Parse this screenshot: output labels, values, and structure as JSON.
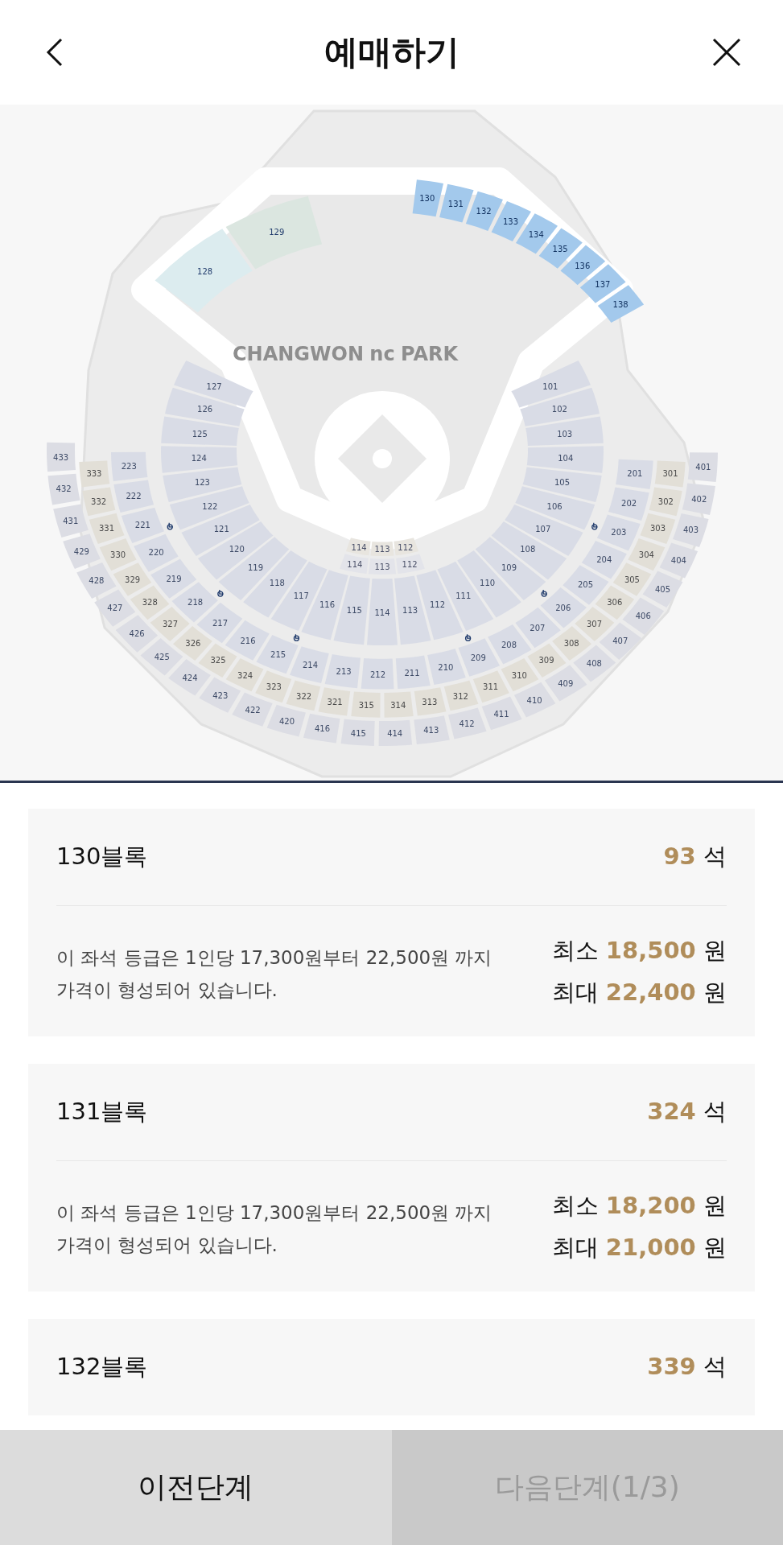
{
  "header": {
    "title": "예매하기"
  },
  "map": {
    "logo": [
      "CHANGWON",
      "nc",
      "PARK"
    ],
    "rings": [
      {
        "kind": "outfield-left",
        "sections": [
          {
            "label": "128",
            "selected": false,
            "color": "#dcecef"
          },
          {
            "label": "129",
            "selected": false,
            "color": "#dbe6e0"
          }
        ]
      },
      {
        "kind": "outfield-right",
        "sections": [
          {
            "label": "130",
            "selected": true
          },
          {
            "label": "131",
            "selected": true
          },
          {
            "label": "132",
            "selected": true
          },
          {
            "label": "133",
            "selected": true
          },
          {
            "label": "134",
            "selected": true
          },
          {
            "label": "135",
            "selected": true
          },
          {
            "label": "136",
            "selected": true
          },
          {
            "label": "137",
            "selected": true
          },
          {
            "label": "138",
            "selected": true
          }
        ]
      },
      {
        "kind": "lower-left",
        "sections": [
          {
            "label": "127",
            "selected": false
          },
          {
            "label": "126",
            "selected": false
          },
          {
            "label": "125",
            "selected": false
          },
          {
            "label": "124",
            "selected": false
          },
          {
            "label": "123",
            "selected": false
          },
          {
            "label": "122",
            "selected": false
          },
          {
            "label": "121",
            "selected": false
          },
          {
            "label": "120",
            "selected": false
          },
          {
            "label": "119",
            "selected": false
          },
          {
            "label": "118",
            "selected": false
          },
          {
            "label": "117",
            "selected": false
          },
          {
            "label": "116",
            "selected": false
          },
          {
            "label": "115",
            "selected": false
          },
          {
            "label": "114",
            "selected": false
          },
          {
            "label": "113",
            "selected": false
          },
          {
            "label": "112",
            "selected": false
          }
        ]
      },
      {
        "kind": "lower-right",
        "sections": [
          {
            "label": "101",
            "selected": false
          },
          {
            "label": "102",
            "selected": false
          },
          {
            "label": "103",
            "selected": false
          },
          {
            "label": "104",
            "selected": false
          },
          {
            "label": "105",
            "selected": false
          },
          {
            "label": "106",
            "selected": false
          },
          {
            "label": "107",
            "selected": false
          },
          {
            "label": "108",
            "selected": false
          },
          {
            "label": "109",
            "selected": false
          },
          {
            "label": "110",
            "selected": false
          },
          {
            "label": "111",
            "selected": false
          }
        ]
      },
      {
        "kind": "premium-inner",
        "sections": [
          {
            "label": "114",
            "selected": false
          },
          {
            "label": "113",
            "selected": false
          },
          {
            "label": "112",
            "selected": false
          }
        ]
      },
      {
        "kind": "premium-mid",
        "sections": [
          {
            "label": "114",
            "selected": false
          },
          {
            "label": "113",
            "selected": false
          },
          {
            "label": "112",
            "selected": false
          }
        ]
      },
      {
        "kind": "second",
        "sections": [
          {
            "label": "223",
            "selected": false
          },
          {
            "label": "222",
            "selected": false
          },
          {
            "label": "221",
            "selected": false
          },
          {
            "label": "220",
            "selected": false
          },
          {
            "label": "219",
            "selected": false
          },
          {
            "label": "218",
            "selected": false
          },
          {
            "label": "217",
            "selected": false
          },
          {
            "label": "216",
            "selected": false
          },
          {
            "label": "215",
            "selected": false
          },
          {
            "label": "214",
            "selected": false
          },
          {
            "label": "213",
            "selected": false
          },
          {
            "label": "212",
            "selected": false
          },
          {
            "label": "211",
            "selected": false
          },
          {
            "label": "210",
            "selected": false
          },
          {
            "label": "209",
            "selected": false
          },
          {
            "label": "208",
            "selected": false
          },
          {
            "label": "207",
            "selected": false
          },
          {
            "label": "206",
            "selected": false
          },
          {
            "label": "205",
            "selected": false
          },
          {
            "label": "204",
            "selected": false
          },
          {
            "label": "203",
            "selected": false
          },
          {
            "label": "202",
            "selected": false
          },
          {
            "label": "201",
            "selected": false
          }
        ]
      },
      {
        "kind": "third",
        "sections": [
          {
            "label": "333",
            "selected": false
          },
          {
            "label": "332",
            "selected": false
          },
          {
            "label": "331",
            "selected": false
          },
          {
            "label": "330",
            "selected": false
          },
          {
            "label": "329",
            "selected": false
          },
          {
            "label": "328",
            "selected": false
          },
          {
            "label": "327",
            "selected": false
          },
          {
            "label": "326",
            "selected": false
          },
          {
            "label": "325",
            "selected": false
          },
          {
            "label": "324",
            "selected": false
          },
          {
            "label": "323",
            "selected": false
          },
          {
            "label": "322",
            "selected": false
          },
          {
            "label": "321",
            "selected": false
          },
          {
            "label": "315",
            "selected": false
          },
          {
            "label": "314",
            "selected": false
          },
          {
            "label": "313",
            "selected": false
          },
          {
            "label": "312",
            "selected": false
          },
          {
            "label": "311",
            "selected": false
          },
          {
            "label": "310",
            "selected": false
          },
          {
            "label": "309",
            "selected": false
          },
          {
            "label": "308",
            "selected": false
          },
          {
            "label": "307",
            "selected": false
          },
          {
            "label": "306",
            "selected": false
          },
          {
            "label": "305",
            "selected": false
          },
          {
            "label": "304",
            "selected": false
          },
          {
            "label": "303",
            "selected": false
          },
          {
            "label": "302",
            "selected": false
          },
          {
            "label": "301",
            "selected": false
          }
        ]
      },
      {
        "kind": "fourth",
        "sections": [
          {
            "label": "433",
            "selected": false
          },
          {
            "label": "432",
            "selected": false
          },
          {
            "label": "431",
            "selected": false
          },
          {
            "label": "429",
            "selected": false
          },
          {
            "label": "428",
            "selected": false
          },
          {
            "label": "427",
            "selected": false
          },
          {
            "label": "426",
            "selected": false
          },
          {
            "label": "425",
            "selected": false
          },
          {
            "label": "424",
            "selected": false
          },
          {
            "label": "423",
            "selected": false
          },
          {
            "label": "422",
            "selected": false
          },
          {
            "label": "420",
            "selected": false
          },
          {
            "label": "416",
            "selected": false
          },
          {
            "label": "415",
            "selected": false
          },
          {
            "label": "414",
            "selected": false
          },
          {
            "label": "413",
            "selected": false
          },
          {
            "label": "412",
            "selected": false
          },
          {
            "label": "411",
            "selected": false
          },
          {
            "label": "410",
            "selected": false
          },
          {
            "label": "409",
            "selected": false
          },
          {
            "label": "408",
            "selected": false
          },
          {
            "label": "407",
            "selected": false
          },
          {
            "label": "406",
            "selected": false
          },
          {
            "label": "405",
            "selected": false
          },
          {
            "label": "404",
            "selected": false
          },
          {
            "label": "403",
            "selected": false
          },
          {
            "label": "402",
            "selected": false
          },
          {
            "label": "401",
            "selected": false
          }
        ]
      }
    ]
  },
  "blocks": [
    {
      "name": "130블록",
      "count": "93",
      "count_unit": "석",
      "description": "이 좌석 등급은 1인당 17,300원부터 22,500원 까지 가격이 형성되어 있습니다.",
      "prices": [
        {
          "label": "최소",
          "value": "18,500",
          "unit": "원"
        },
        {
          "label": "최대",
          "value": "22,400",
          "unit": "원"
        }
      ]
    },
    {
      "name": "131블록",
      "count": "324",
      "count_unit": "석",
      "description": "이 좌석 등급은 1인당 17,300원부터 22,500원 까지 가격이 형성되어 있습니다.",
      "prices": [
        {
          "label": "최소",
          "value": "18,200",
          "unit": "원"
        },
        {
          "label": "최대",
          "value": "21,000",
          "unit": "원"
        }
      ]
    },
    {
      "name": "132블록",
      "count": "339",
      "count_unit": "석"
    }
  ],
  "footer": {
    "buttons": [
      {
        "label": "이전단계",
        "disabled": false
      },
      {
        "label": "다음단계(1/3)",
        "disabled": true
      }
    ]
  }
}
